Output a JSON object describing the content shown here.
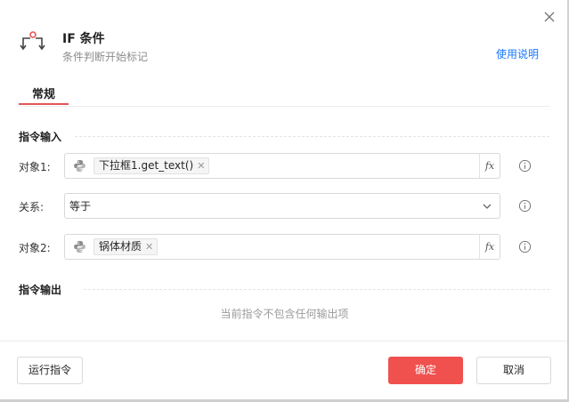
{
  "dialog": {
    "title": "IF 条件",
    "subtitle": "条件判断开始标记",
    "help_link": "使用说明"
  },
  "tabs": [
    {
      "label": "常规",
      "active": true
    }
  ],
  "input_section": {
    "title": "指令输入",
    "fields": [
      {
        "label": "对象1:",
        "type": "expression",
        "tag": "下拉框1.get_text()",
        "icon": "python-icon",
        "fx_label": "fx"
      },
      {
        "label": "关系:",
        "type": "select",
        "value": "等于"
      },
      {
        "label": "对象2:",
        "type": "expression",
        "tag": "锅体材质",
        "icon": "python-icon",
        "fx_label": "fx"
      }
    ]
  },
  "output_section": {
    "title": "指令输出",
    "empty_text": "当前指令不包含任何输出项"
  },
  "footer": {
    "run_label": "运行指令",
    "confirm_label": "确定",
    "cancel_label": "取消"
  },
  "colors": {
    "accent": "#f0514f",
    "link": "#1677ff",
    "tab_underline": "#e55555"
  }
}
